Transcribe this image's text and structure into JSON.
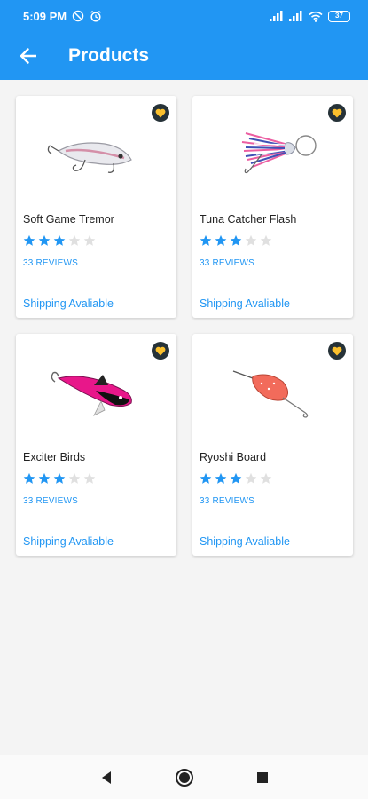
{
  "status_bar": {
    "time": "5:09 PM",
    "battery": "37"
  },
  "toolbar": {
    "title": "Products"
  },
  "products": [
    {
      "name": "Soft Game Tremor",
      "rating": 3,
      "max_rating": 5,
      "reviews": "33 REVIEWS",
      "shipping": "Shipping Avaliable",
      "image": "silver-minnow-lure"
    },
    {
      "name": "Tuna Catcher Flash",
      "rating": 3,
      "max_rating": 5,
      "reviews": "33 REVIEWS",
      "shipping": "Shipping Avaliable",
      "image": "pink-blue-skirt-lure"
    },
    {
      "name": "Exciter Birds",
      "rating": 3,
      "max_rating": 5,
      "reviews": "33 REVIEWS",
      "shipping": "Shipping Avaliable",
      "image": "pink-black-bird-lure"
    },
    {
      "name": "Ryoshi Board",
      "rating": 3,
      "max_rating": 5,
      "reviews": "33 REVIEWS",
      "shipping": "Shipping Avaliable",
      "image": "orange-spoon-lure"
    }
  ],
  "colors": {
    "primary": "#2196f3",
    "star_filled": "#2196f3",
    "star_empty": "#e0e0e0",
    "favorite_badge": "#263238",
    "favorite_heart": "#fbc02d"
  }
}
